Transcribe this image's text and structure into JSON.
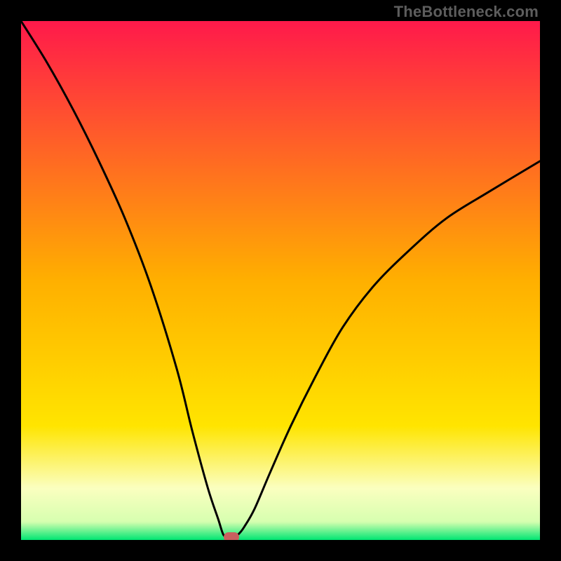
{
  "watermark": "TheBottleneck.com",
  "colors": {
    "top": "#ff1a4b",
    "mid": "#ffd400",
    "pale": "#fbffc0",
    "bottom": "#00e673",
    "curve": "#000000",
    "marker": "#c9605f",
    "frame": "#000000"
  },
  "chart_data": {
    "type": "line",
    "title": "",
    "xlabel": "",
    "ylabel": "",
    "xlim": [
      0,
      100
    ],
    "ylim": [
      0,
      100
    ],
    "grid": false,
    "legend": false,
    "series": [
      {
        "name": "bottleneck-curve",
        "x": [
          0,
          5,
          10,
          15,
          20,
          25,
          30,
          33,
          36,
          38,
          39,
          40,
          41,
          42,
          43,
          45,
          48,
          52,
          57,
          62,
          68,
          75,
          82,
          90,
          100
        ],
        "values": [
          100,
          92,
          83,
          73,
          62,
          49,
          33,
          21,
          10,
          4,
          1,
          0.5,
          0.5,
          1.2,
          2.5,
          6,
          13,
          22,
          32,
          41,
          49,
          56,
          62,
          67,
          73
        ]
      }
    ],
    "annotations": [
      {
        "name": "optimum-marker",
        "x": 40.5,
        "y": 0.5
      }
    ],
    "background_gradient_stops": [
      {
        "pos": 0.0,
        "color": "#ff1a4b"
      },
      {
        "pos": 0.5,
        "color": "#ffb000"
      },
      {
        "pos": 0.78,
        "color": "#ffe500"
      },
      {
        "pos": 0.9,
        "color": "#fbffc0"
      },
      {
        "pos": 0.965,
        "color": "#d7ffb0"
      },
      {
        "pos": 1.0,
        "color": "#00e673"
      }
    ]
  }
}
